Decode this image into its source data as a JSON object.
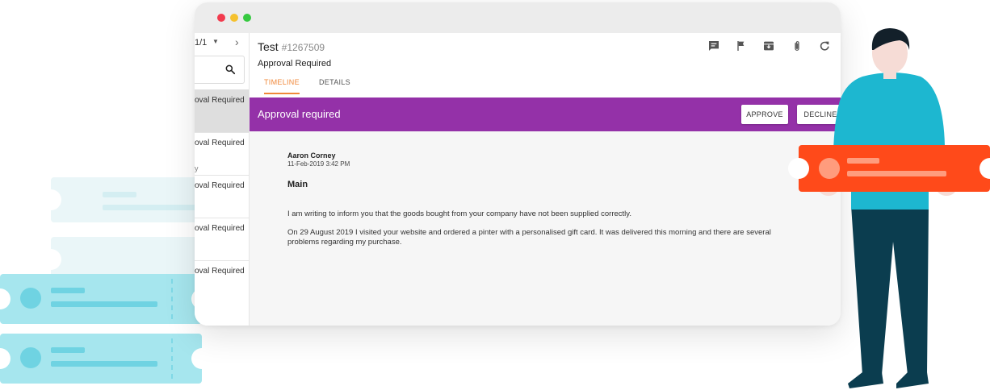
{
  "list_pane": {
    "pager": "1/1",
    "items": [
      {
        "label": "oval Required",
        "fragment": ""
      },
      {
        "label": "oval Required",
        "fragment": "y"
      },
      {
        "label": "oval Required",
        "fragment": ""
      },
      {
        "label": "oval Required",
        "fragment": ""
      },
      {
        "label": "oval Required",
        "fragment": ""
      }
    ]
  },
  "ticket": {
    "title": "Test",
    "id": "#1267509",
    "status": "Approval Required",
    "tabs": [
      {
        "label": "TIMELINE",
        "active": true
      },
      {
        "label": "DETAILS",
        "active": false
      }
    ],
    "toolbar_icons": [
      "comment-icon",
      "flag-icon",
      "archive-icon",
      "attachment-icon",
      "refresh-icon"
    ]
  },
  "banner": {
    "title": "Approval required",
    "approve_label": "APPROVE",
    "decline_label": "DECLINE",
    "color": "#9431a8"
  },
  "message": {
    "author": "Aaron Corney",
    "date": "11-Feb-2019 3:42 PM",
    "subject": "Main",
    "paragraphs": [
      "I am writing to inform you that the goods bought from your company have not been supplied correctly.",
      "On 29 August 2019 I visited your website and ordered a pinter with a personalised gift card. It was delivered this morning and there are several problems regarding my purchase."
    ]
  },
  "colors": {
    "accent_tab": "#f0883a",
    "ticket_orange": "#ff4a1a",
    "ticket_cyan": "#a6e6ee",
    "person_shirt": "#1db7d0",
    "person_pants": "#0b3d4f"
  }
}
